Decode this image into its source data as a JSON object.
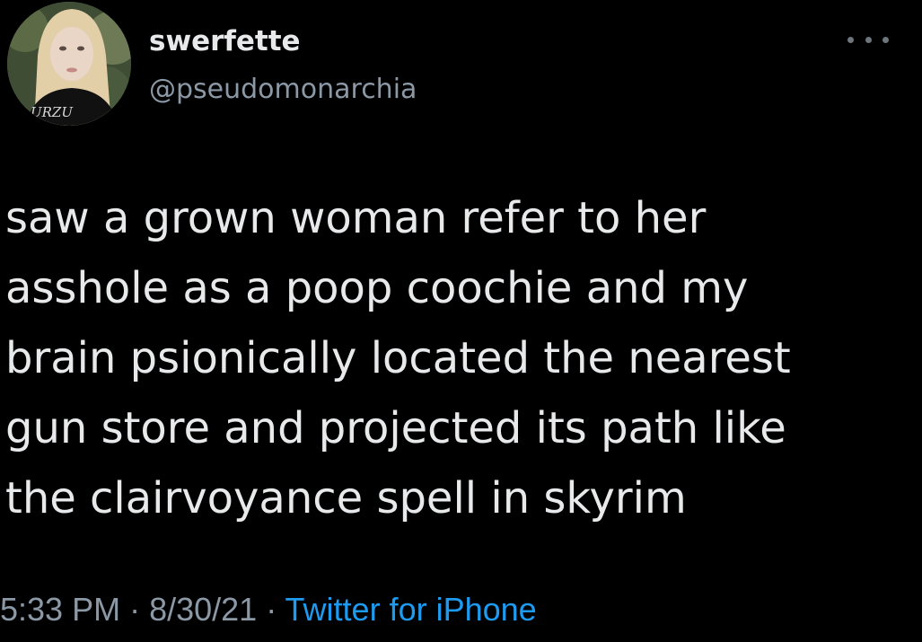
{
  "user": {
    "display_name": "swerfette",
    "handle": "@pseudomonarchia",
    "avatar_shirt_text": "URZU"
  },
  "tweet": {
    "lines": [
      "saw a grown woman refer to her",
      "asshole as a poop coochie and my",
      "brain psionically located the nearest",
      "gun store and projected its path like",
      "the clairvoyance spell in skyrim"
    ],
    "time": "5:33 PM",
    "date": "8/30/21",
    "separator": " · ",
    "source": "Twitter for iPhone"
  },
  "icons": {
    "more": "more-options-icon"
  },
  "colors": {
    "background": "#000000",
    "text": "#e7e9ea",
    "secondary": "#8b98a5",
    "link": "#1d9bf0"
  }
}
